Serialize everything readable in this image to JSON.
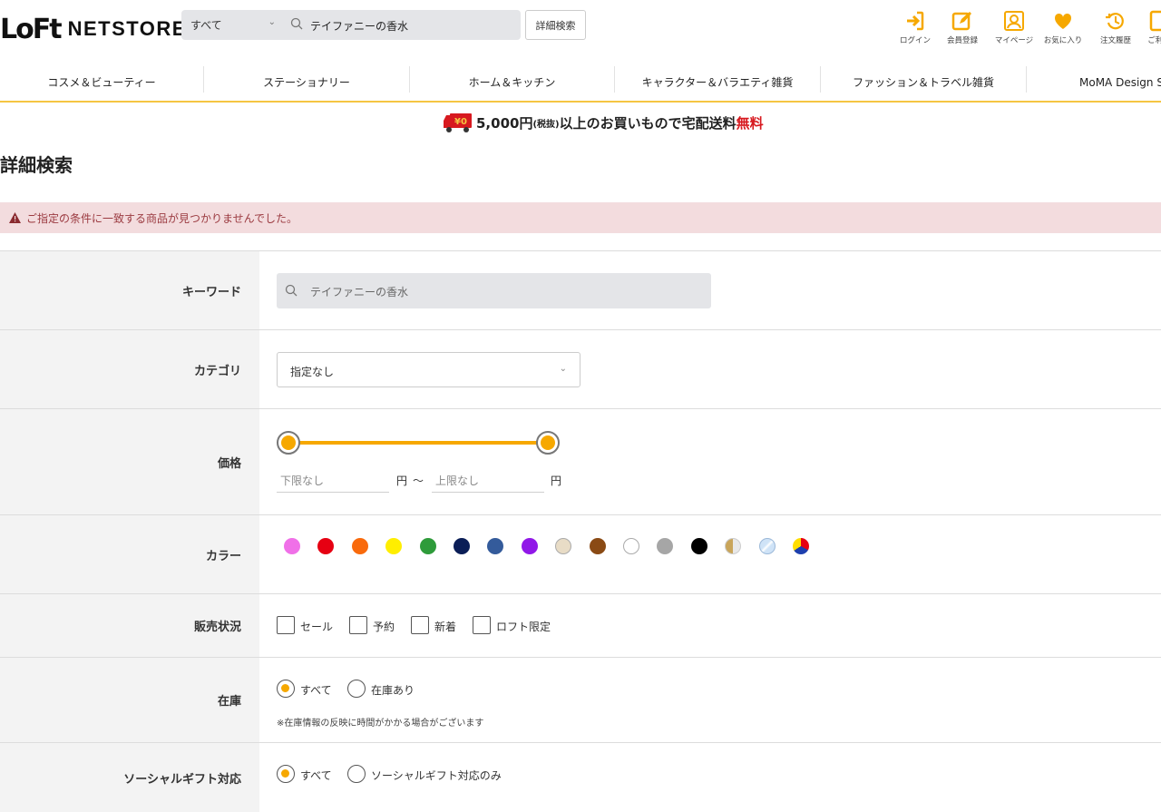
{
  "header": {
    "logo_mark": "LoFt",
    "logo_text": "NETSTORE",
    "search_scope": "すべて",
    "search_value": "テイファニーの香水",
    "advanced_button": "詳細検索",
    "icons": [
      {
        "name": "login-icon",
        "label": "ログイン"
      },
      {
        "name": "member-register-icon",
        "label": "会員登録"
      },
      {
        "name": "mypage-icon",
        "label": "マイページ"
      },
      {
        "name": "favorite-icon",
        "label": "お気に入り"
      },
      {
        "name": "order-history-icon",
        "label": "注文履歴"
      },
      {
        "name": "guide-icon",
        "label": "ご利用"
      }
    ],
    "accent_color": "#f6a800"
  },
  "nav": {
    "items": [
      "コスメ＆ビューティー",
      "ステーショナリー",
      "ホーム＆キッチン",
      "キャラクター＆バラエティ雑貨",
      "ファッション＆トラベル雑貨",
      "MoMA Design Store"
    ]
  },
  "banner": {
    "badge": "¥0",
    "amount": "5,000円",
    "tax": "(税抜)",
    "text": "以上のお買いもので宅配送料",
    "free": "無料"
  },
  "page": {
    "title": "詳細検索",
    "alert": "ご指定の条件に一致する商品が見つかりませんでした。"
  },
  "form": {
    "keyword": {
      "label": "キーワード",
      "value": "テイファニーの香水"
    },
    "category": {
      "label": "カテゴリ",
      "selected": "指定なし"
    },
    "price": {
      "label": "価格",
      "min_placeholder": "下限なし",
      "max_placeholder": "上限なし",
      "unit": "円",
      "separator": "～",
      "range_min_fraction": 0,
      "range_max_fraction": 1
    },
    "color": {
      "label": "カラー",
      "swatches": [
        "#f070e8",
        "#e60012",
        "#f96a0c",
        "#ffee00",
        "#2e9b3a",
        "#0b1e57",
        "#345b9b",
        "#9118e8",
        "#e8dcc6",
        "#8a4a14",
        "#ffffff",
        "#a6a6a6",
        "#000000",
        "gold-half",
        "clear",
        "multi"
      ]
    },
    "sale_status": {
      "label": "販売状況",
      "options": [
        "セール",
        "予約",
        "新着",
        "ロフト限定"
      ]
    },
    "stock": {
      "label": "在庫",
      "options": [
        "すべて",
        "在庫あり"
      ],
      "selected": "すべて",
      "note": "※在庫情報の反映に時間がかかる場合がございます"
    },
    "social_gift": {
      "label": "ソーシャルギフト対応",
      "options": [
        "すべて",
        "ソーシャルギフト対応のみ"
      ],
      "selected": "すべて"
    }
  }
}
